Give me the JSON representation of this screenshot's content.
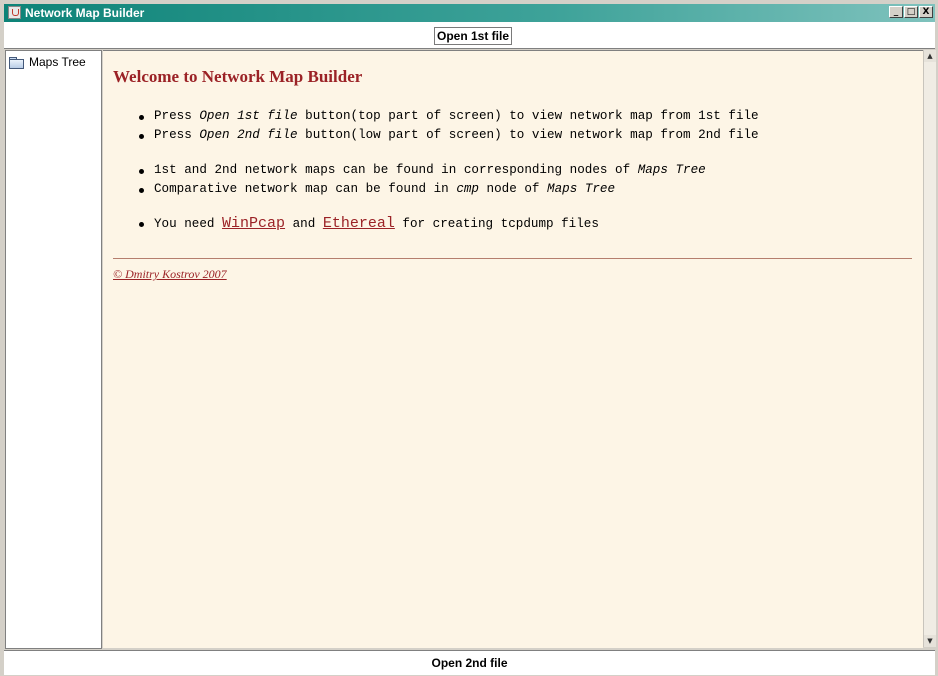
{
  "window": {
    "title": "Network Map Builder",
    "controls": {
      "minimize": "_",
      "maximize": "□",
      "close": "X"
    }
  },
  "toolbar": {
    "open_first_label": "Open 1st file",
    "open_second_label": "Open 2nd file"
  },
  "tree": {
    "root_label": "Maps Tree",
    "root_icon": "folder-icon"
  },
  "content": {
    "heading": "Welcome to Network Map Builder",
    "bullets_group1": [
      {
        "pre": "Press ",
        "em": "Open 1st file",
        "post": " button(top part of screen) to view network map from 1st file"
      },
      {
        "pre": "Press ",
        "em": "Open 2nd file",
        "post": " button(low part of screen) to view network map from 2nd file"
      }
    ],
    "bullets_group2": [
      {
        "pre": "1st and 2nd network maps can be found in corresponding nodes of ",
        "em": "Maps Tree",
        "post": ""
      },
      {
        "pre": "Comparative network map can be found in ",
        "em": "cmp",
        "mid": " node of ",
        "em2": "Maps Tree"
      }
    ],
    "bullets_group3": {
      "pre": "You need ",
      "link1": "WinPcap",
      "mid": " and ",
      "link2": "Ethereal",
      "post": " for creating tcpdump files"
    },
    "copyright": "© Dmitry Kostrov 2007",
    "link_color": "#9b2226",
    "background_color": "#fdf5e6"
  },
  "scrollbar": {
    "up_arrow": "▲",
    "down_arrow": "▼"
  }
}
